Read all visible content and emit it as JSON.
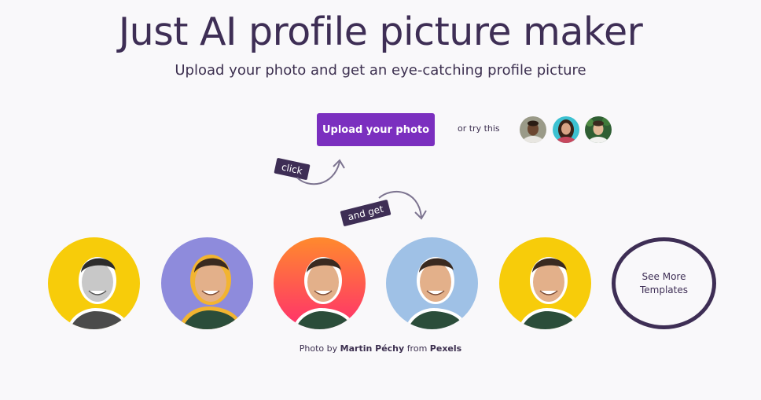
{
  "header": {
    "title": "Just AI profile picture maker",
    "subtitle": "Upload your photo and get an eye-catching profile picture"
  },
  "upload": {
    "button_label": "Upload your photo",
    "try_text": "or try this",
    "samples": [
      {
        "icon": "sample-face-man-icon"
      },
      {
        "icon": "sample-face-woman-icon"
      },
      {
        "icon": "sample-face-man-green-icon"
      }
    ]
  },
  "stickers": {
    "click": "click",
    "and_get": "and get"
  },
  "templates": [
    {
      "name": "yellow-grayscale",
      "bg": "#f7cc0a"
    },
    {
      "name": "purple-outline",
      "bg": "#8e8bdc"
    },
    {
      "name": "orange-pink-gradient",
      "bg": "#ff6b3d"
    },
    {
      "name": "light-blue",
      "bg": "#9fc1e6"
    },
    {
      "name": "yellow-color",
      "bg": "#f7cc0a"
    }
  ],
  "see_more": {
    "label_line1": "See More",
    "label_line2": "Templates"
  },
  "credit": {
    "prefix": "Photo by",
    "author": "Martin Péchy",
    "middle": "from",
    "source": "Pexels"
  },
  "colors": {
    "accent": "#7b2fbf",
    "dark": "#3e2e55",
    "background": "#f9f8fa"
  }
}
